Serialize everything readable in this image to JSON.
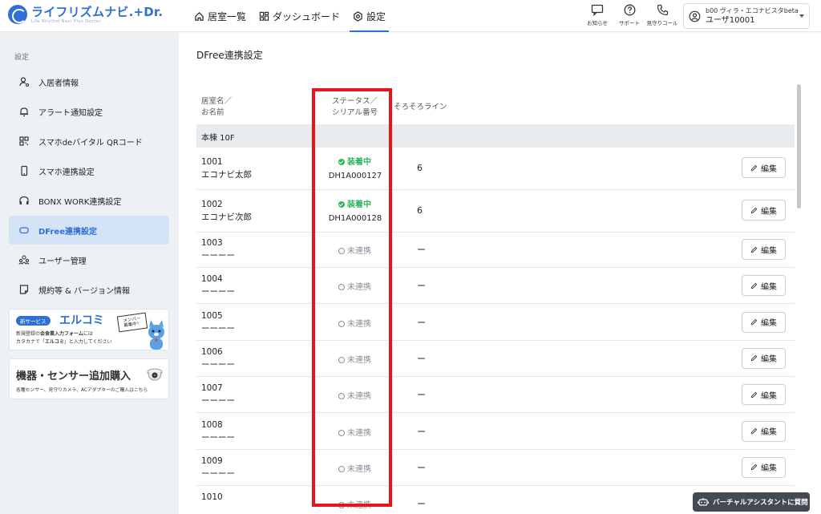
{
  "brand": {
    "name": "ライフリズムナビ.+Dr.",
    "tagline": "Life Rhythm Navi  Plus Doctor",
    "color": "#2f6fd6"
  },
  "nav": [
    {
      "label": "居室一覧",
      "icon": "home-icon"
    },
    {
      "label": "ダッシュボード",
      "icon": "dashboard-icon"
    },
    {
      "label": "設定",
      "icon": "gear-icon",
      "active": true
    }
  ],
  "header_actions": [
    {
      "label": "お知らせ",
      "icon": "notice-icon"
    },
    {
      "label": "サポート",
      "icon": "help-icon"
    },
    {
      "label": "見守りコール",
      "icon": "phone-icon"
    }
  ],
  "user": {
    "facility": "b00 ヴィラ・エコナビスタbeta",
    "name": "ユーザ10001"
  },
  "sidebar": {
    "title": "設定",
    "items": [
      {
        "label": "入居者情報",
        "icon": "resident-icon"
      },
      {
        "label": "アラート通知設定",
        "icon": "bell-icon"
      },
      {
        "label": "スマホdeバイタル QRコード",
        "icon": "qr-icon"
      },
      {
        "label": "スマホ連携設定",
        "icon": "smartphone-icon"
      },
      {
        "label": "BONX WORK連携設定",
        "icon": "headset-icon"
      },
      {
        "label": "DFree連携設定",
        "icon": "dfree-icon",
        "active": true
      },
      {
        "label": "ユーザー管理",
        "icon": "users-icon"
      },
      {
        "label": "規約等 & バージョン情報",
        "icon": "document-icon"
      }
    ],
    "banner1": {
      "tag": "新サービス",
      "title": "エルコミ",
      "desc1": "新規登録の",
      "desc1_strong": "会食業入力フォーム",
      "desc1_tail": "には",
      "desc2": "カタカナで「",
      "desc2_strong": "エルコミ",
      "desc2_tail": "」と入力してください",
      "sign_line1": "メンバー",
      "sign_line2": "募集中！"
    },
    "banner2": {
      "title": "機器・センサー追加購入",
      "desc": "各種センサー、見守りカメラ、ACアダプターのご購入はこちら"
    }
  },
  "main": {
    "title": "DFree連携設定",
    "columns": {
      "room_line1": "居室名／",
      "room_line2": "お名前",
      "status_line1": "ステータス／",
      "status_line2": "シリアル番号",
      "soro": "そろそろライン"
    },
    "section": "本棟 10F",
    "edit_label": "編集",
    "rows": [
      {
        "room": "1001",
        "name": "エコナビ太郎",
        "status": "装着中",
        "serial": "DH1A000127",
        "soro": "6"
      },
      {
        "room": "1002",
        "name": "エコナビ次郎",
        "status": "装着中",
        "serial": "DH1A000128",
        "soro": "6"
      },
      {
        "room": "1003",
        "name": "ーーーー",
        "status": "未連携",
        "soro": "ー"
      },
      {
        "room": "1004",
        "name": "ーーーー",
        "status": "未連携",
        "soro": "ー"
      },
      {
        "room": "1005",
        "name": "ーーーー",
        "status": "未連携",
        "soro": "ー"
      },
      {
        "room": "1006",
        "name": "ーーーー",
        "status": "未連携",
        "soro": "ー"
      },
      {
        "room": "1007",
        "name": "ーーーー",
        "status": "未連携",
        "soro": "ー"
      },
      {
        "room": "1008",
        "name": "ーーーー",
        "status": "未連携",
        "soro": "ー"
      },
      {
        "room": "1009",
        "name": "ーーーー",
        "status": "未連携",
        "soro": "ー"
      },
      {
        "room": "1010",
        "name": "",
        "status": "未連携",
        "soro": "ー"
      }
    ]
  },
  "assistant": {
    "label": "バーチャルアシスタントに質問"
  },
  "colors": {
    "connected": "#2fb55a",
    "highlight": "#e8141b",
    "sidebar_active": "#d5e3f7"
  }
}
